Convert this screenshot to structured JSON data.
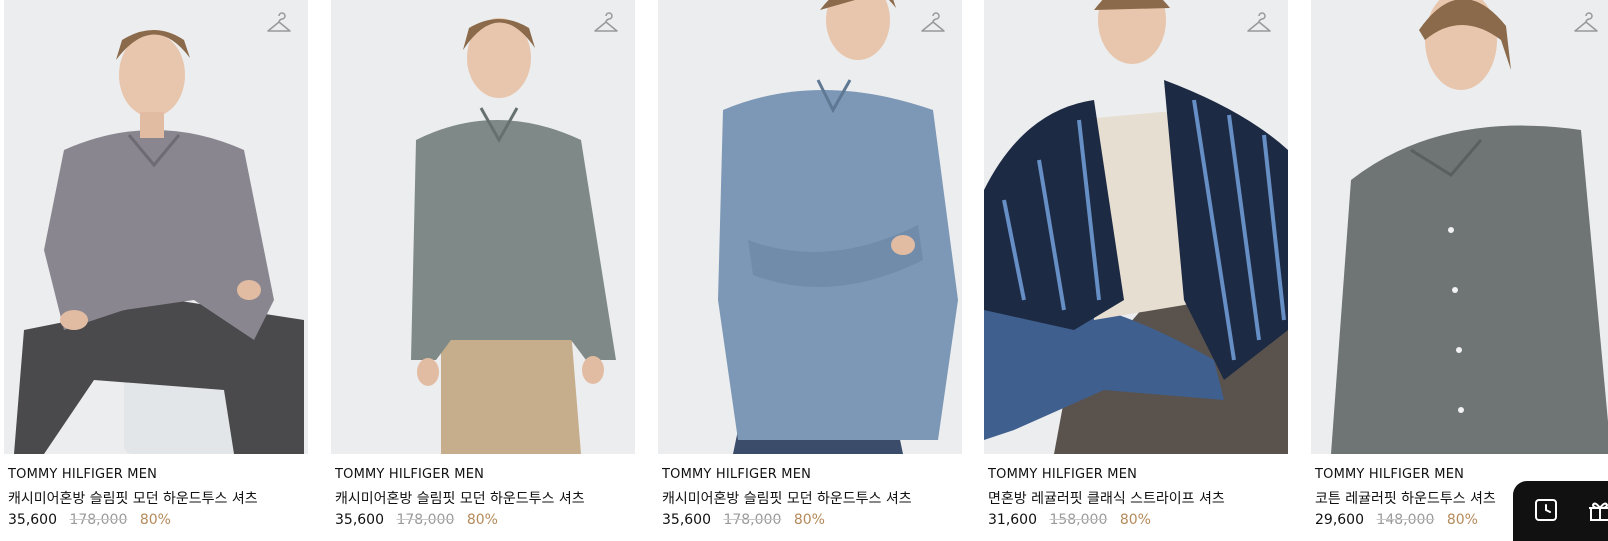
{
  "products": [
    {
      "brand": "TOMMY HILFIGER MEN",
      "name": "캐시미어혼방 슬림핏 모던 하운드투스 셔츠",
      "sale_price": "35,600",
      "original_price": "178,000",
      "discount": "80%",
      "shirt_color": "#8a8690",
      "pants_color": "#4a4a4c",
      "wishlist_icon": "hanger-icon"
    },
    {
      "brand": "TOMMY HILFIGER MEN",
      "name": "캐시미어혼방 슬림핏 모던 하운드투스 셔츠",
      "sale_price": "35,600",
      "original_price": "178,000",
      "discount": "80%",
      "shirt_color": "#7f8a88",
      "pants_color": "#c6ad8c",
      "wishlist_icon": "hanger-icon"
    },
    {
      "brand": "TOMMY HILFIGER MEN",
      "name": "캐시미어혼방 슬림핏 모던 하운드투스 셔츠",
      "sale_price": "35,600",
      "original_price": "178,000",
      "discount": "80%",
      "shirt_color": "#7d98b6",
      "pants_color": "#3b4c6b",
      "wishlist_icon": "hanger-icon"
    },
    {
      "brand": "TOMMY HILFIGER MEN",
      "name": "면혼방 레귤러핏 클래식 스트라이프 셔츠",
      "sale_price": "31,600",
      "original_price": "158,000",
      "discount": "80%",
      "shirt_color": "#1d2a44",
      "pants_color": "#3f5f8e",
      "wishlist_icon": "hanger-icon"
    },
    {
      "brand": "TOMMY HILFIGER MEN",
      "name": "코튼 레귤러핏 하운드투스 셔츠",
      "sale_price": "29,600",
      "original_price": "148,000",
      "discount": "80%",
      "shirt_color": "#6f7474",
      "pants_color": "#555a5a",
      "wishlist_icon": "hanger-icon"
    }
  ],
  "floating_bar": {
    "icons": [
      "recent-view-icon",
      "gift-icon"
    ]
  },
  "colors": {
    "photo_background": "#ecedee",
    "price_original": "#9a9a9a",
    "discount": "#b48a5a",
    "floating_bar": "#111111"
  }
}
